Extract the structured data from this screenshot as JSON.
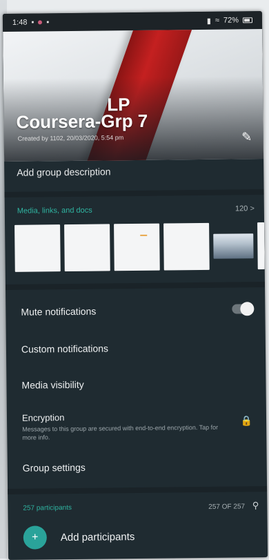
{
  "status_bar": {
    "time": "1:48",
    "battery": "72%"
  },
  "header": {
    "title_line1": "LP",
    "title_line2": "Coursera-Grp 7",
    "created_by": "Created by 1102, 20/03/2020, 5:54 pm"
  },
  "description": {
    "label": "Add group description"
  },
  "media": {
    "label": "Media, links, and docs",
    "count": "120 >"
  },
  "settings": {
    "mute": "Mute notifications",
    "custom": "Custom notifications",
    "media_visibility": "Media visibility",
    "encryption_title": "Encryption",
    "encryption_sub": "Messages to this group are secured with end-to-end encryption. Tap for more info.",
    "group_settings": "Group settings"
  },
  "participants": {
    "label": "257 participants",
    "count": "257 OF 257",
    "add_label": "Add participants"
  },
  "colors": {
    "accent": "#2fb3a0",
    "background": "#1f2b31",
    "ribbon": "#c42020"
  }
}
